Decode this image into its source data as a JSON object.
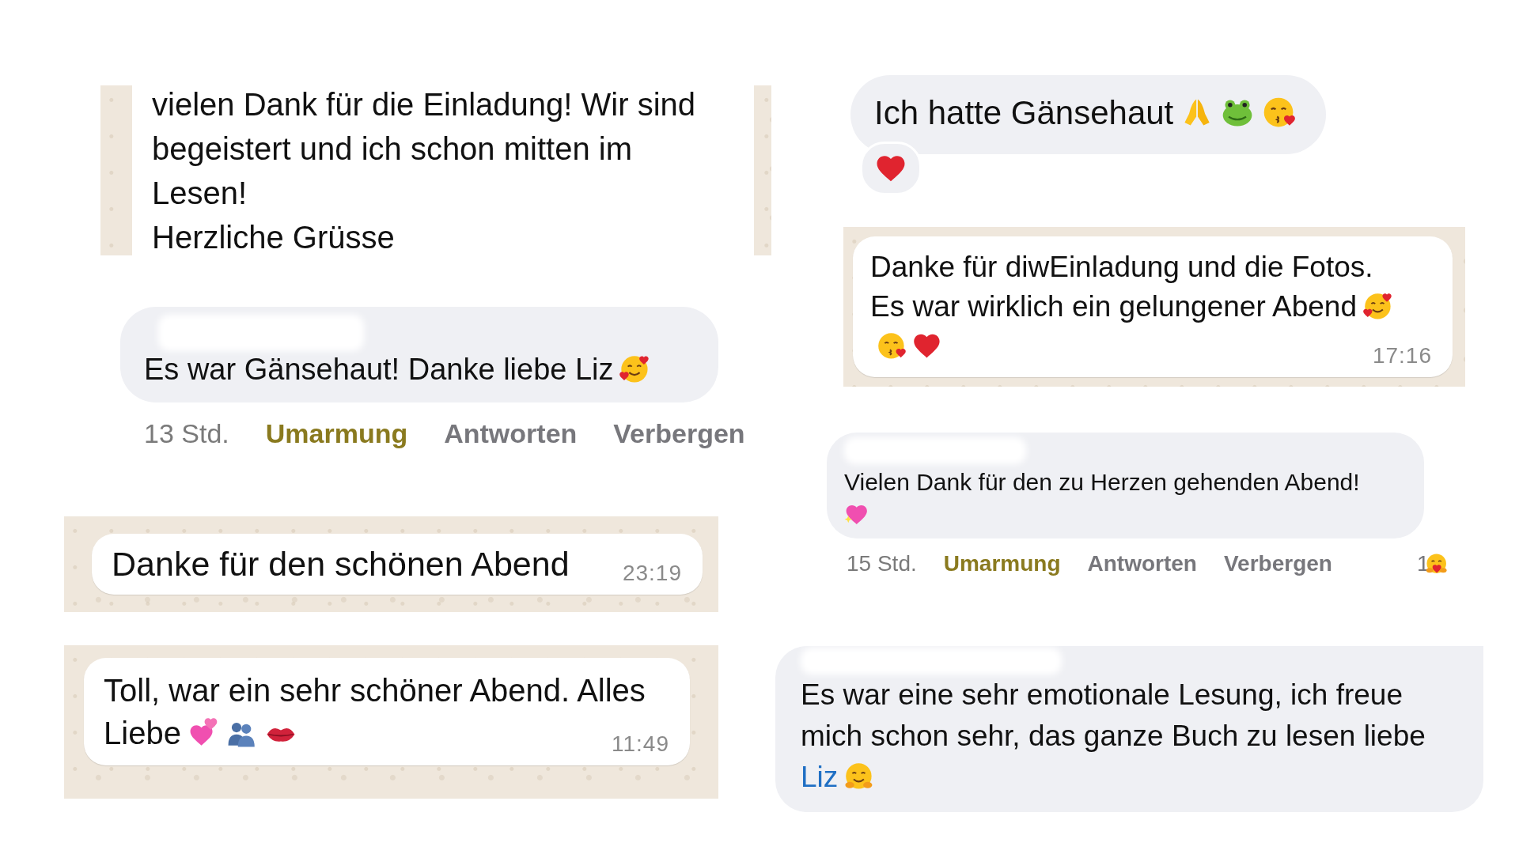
{
  "left": [
    {
      "kind": "wallpaper_text",
      "text": "vielen Dank für die Einladung! Wir sind begeistert und ich schon mitten im\nLesen!\nHerzliche Grüsse"
    },
    {
      "kind": "comment",
      "text": "Es war Gänsehaut! Danke liebe Liz",
      "emojis": [
        {
          "kind": "smiling_hearts"
        }
      ],
      "age": "13 Std.",
      "actions": [
        {
          "label": "Umarmung",
          "selected": true
        },
        {
          "label": "Antworten",
          "selected": false
        },
        {
          "label": "Verbergen",
          "selected": false
        }
      ]
    },
    {
      "kind": "wa_bubble",
      "lines": [
        "Danke für den schönen Abend"
      ],
      "time": "23:19"
    },
    {
      "kind": "wa_bubble",
      "lines": [
        "Toll, war ein sehr schöner Abend. Alles",
        "Liebe"
      ],
      "emojis": [
        {
          "kind": "two_hearts"
        },
        {
          "kind": "busts"
        },
        {
          "kind": "kiss_mark"
        }
      ],
      "time": "11:49"
    }
  ],
  "right": [
    {
      "kind": "bubble",
      "text": "Ich hatte Gänsehaut",
      "emojis": [
        {
          "kind": "pray"
        },
        {
          "kind": "frog"
        },
        {
          "kind": "kiss"
        }
      ],
      "reaction": {
        "kind": "heart"
      }
    },
    {
      "kind": "wa_bubble",
      "lines": [
        "Danke für diwEinladung und die Fotos.",
        "Es war wirklich ein gelungener Abend"
      ],
      "emojis": [
        {
          "kind": "smiling_hearts"
        },
        {
          "kind": "kiss"
        },
        {
          "kind": "heart"
        }
      ],
      "time": "17:16"
    },
    {
      "kind": "comment",
      "text": "Vielen Dank für den zu Herzen gehenden Abend!",
      "emojis": [
        {
          "kind": "sparkling_heart"
        }
      ],
      "age": "15 Std.",
      "actions": [
        {
          "label": "Umarmung",
          "selected": true
        },
        {
          "label": "Antworten",
          "selected": false
        },
        {
          "label": "Verbergen",
          "selected": false
        }
      ],
      "reaction_count": "1",
      "reaction": {
        "kind": "hug_heart"
      }
    },
    {
      "kind": "comment_plain",
      "lines": [
        "Es war eine sehr emotionale Lesung, ich freue",
        "mich schon sehr, das ganze Buch zu lesen liebe"
      ],
      "mention": "Liz",
      "emojis": [
        {
          "kind": "hug"
        }
      ]
    }
  ]
}
